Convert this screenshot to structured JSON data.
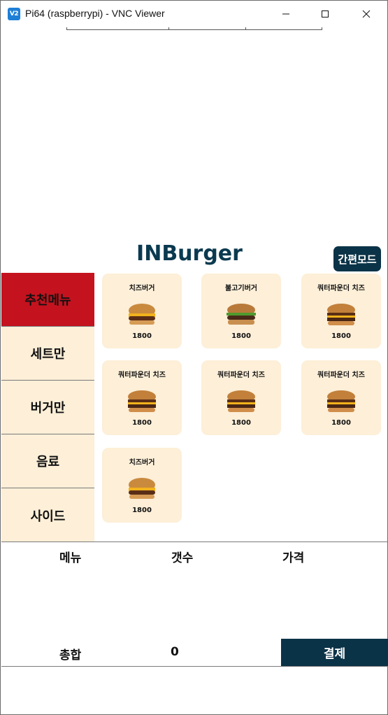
{
  "window": {
    "icon_label": "V2",
    "title": "Pi64 (raspberrypi) - VNC Viewer"
  },
  "app": {
    "brand": "INBurger",
    "simple_mode_label": "간편모드"
  },
  "sidebar": {
    "items": [
      {
        "label": "추천메뉴",
        "active": true
      },
      {
        "label": "세트만",
        "active": false
      },
      {
        "label": "버거만",
        "active": false
      },
      {
        "label": "음료",
        "active": false
      },
      {
        "label": "사이드",
        "active": false
      }
    ]
  },
  "menu": {
    "items": [
      {
        "name": "치즈버거",
        "price": "1800"
      },
      {
        "name": "불고기버거",
        "price": "1800"
      },
      {
        "name": "쿼터파운더 치즈",
        "price": "1800"
      },
      {
        "name": "쿼터파운더 치즈",
        "price": "1800"
      },
      {
        "name": "쿼터파운더 치즈",
        "price": "1800"
      },
      {
        "name": "쿼터파운더 치즈",
        "price": "1800"
      },
      {
        "name": "치즈버거",
        "price": "1800"
      }
    ]
  },
  "cart": {
    "headers": {
      "menu": "메뉴",
      "count": "갯수",
      "price": "가격"
    },
    "total_label": "총합",
    "total_value": "0",
    "pay_label": "결제"
  },
  "colors": {
    "accent_navy": "#0b3347",
    "active_red": "#c4131f",
    "card_bg": "#fdefd8"
  }
}
